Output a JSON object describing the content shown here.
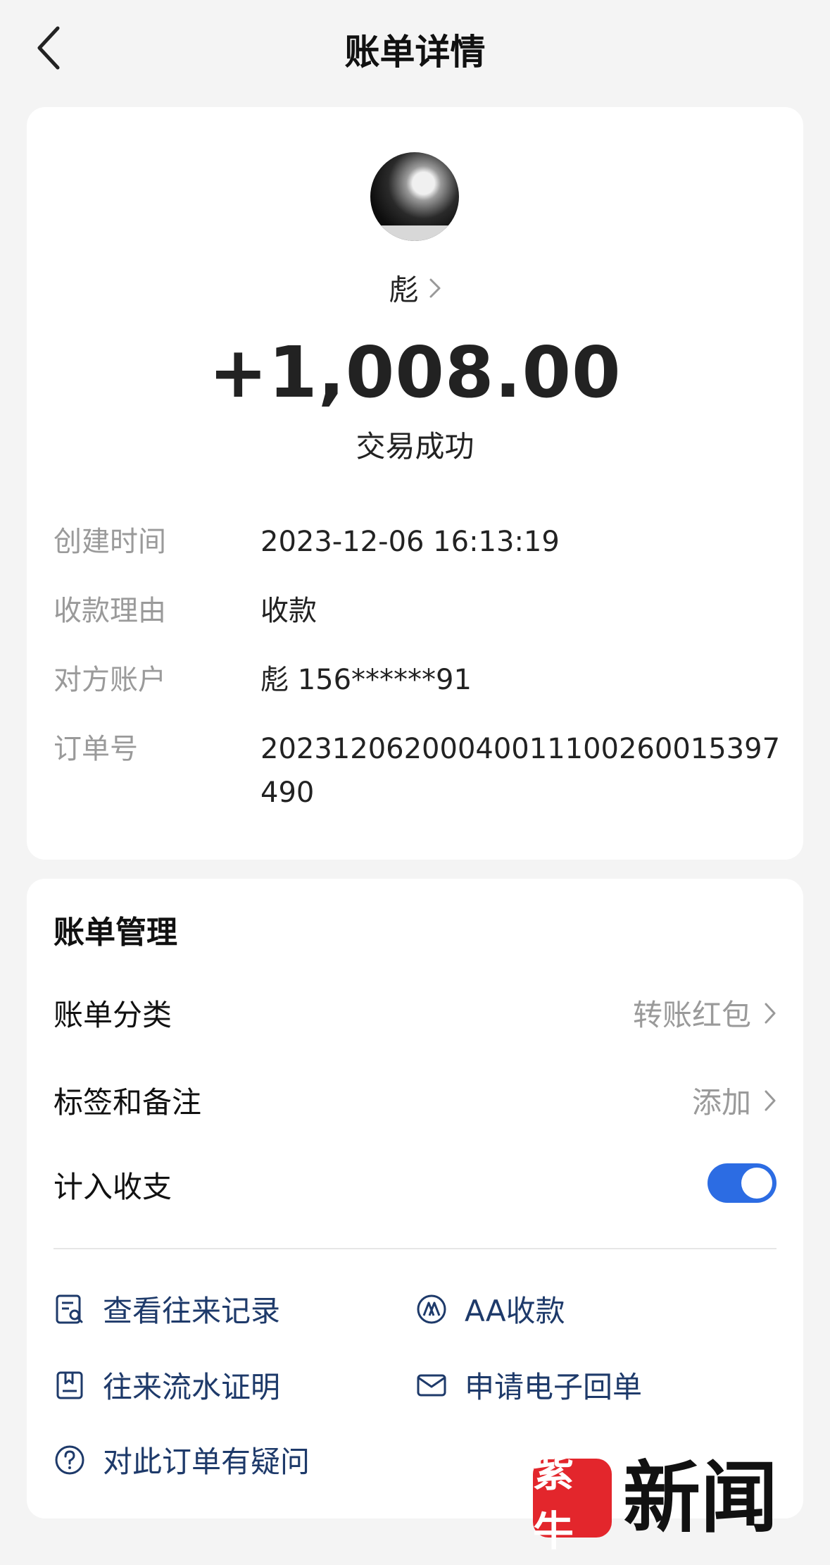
{
  "header": {
    "title": "账单详情"
  },
  "summary": {
    "name": "彪",
    "amount": "+1,008.00",
    "status": "交易成功"
  },
  "details": [
    {
      "label": "创建时间",
      "value": "2023-12-06 16:13:19"
    },
    {
      "label": "收款理由",
      "value": "收款"
    },
    {
      "label": "对方账户",
      "value": "彪 156******91"
    },
    {
      "label": "订单号",
      "value": "20231206200040011100260015397490"
    }
  ],
  "management": {
    "title": "账单管理",
    "category": {
      "label": "账单分类",
      "value": "转账红包"
    },
    "tags": {
      "label": "标签和备注",
      "value": "添加"
    },
    "count_in": {
      "label": "计入收支",
      "enabled": true
    }
  },
  "actions": {
    "history": "查看往来记录",
    "aa": "AA收款",
    "statement": "往来流水证明",
    "receipt": "申请电子回单",
    "question": "对此订单有疑问"
  },
  "watermark": {
    "badge": "紫牛",
    "text": "新闻"
  },
  "colors": {
    "accent": "#2c6ce3",
    "action_text": "#1e3a6a",
    "watermark_red": "#e3262c"
  }
}
